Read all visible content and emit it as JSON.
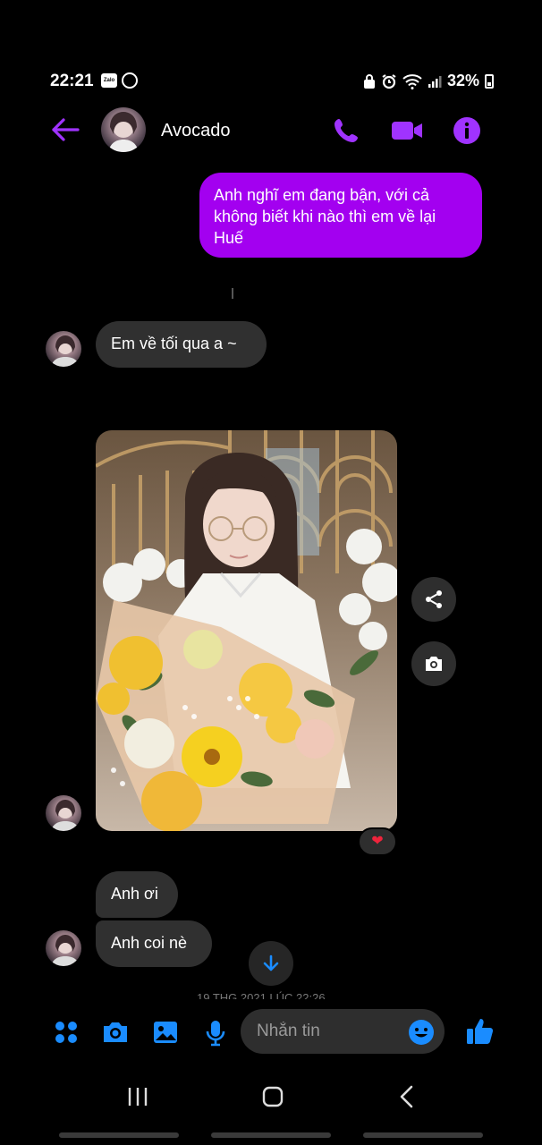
{
  "status_bar": {
    "time": "22:21",
    "app_badge": "Zalo",
    "battery": "32%"
  },
  "header": {
    "contact_name": "Avocado",
    "accent_color": "#a033ff"
  },
  "messages": {
    "outgoing_1": "Anh nghĩ em đang bận, với cả không biết khi nào thì em về lại Huế",
    "incoming_1": "Em về tối qua a ~",
    "reaction": "❤",
    "incoming_2": "Anh ơi",
    "incoming_3": "Anh coi nè",
    "timestamp_partial": "19 THG 2021 LÚC 22:26"
  },
  "composer": {
    "placeholder": "Nhắn tin",
    "icon_color": "#1a8cff"
  },
  "colors": {
    "outgoing_bubble": "#a300f0",
    "incoming_bubble": "#303030",
    "background": "#000000"
  }
}
